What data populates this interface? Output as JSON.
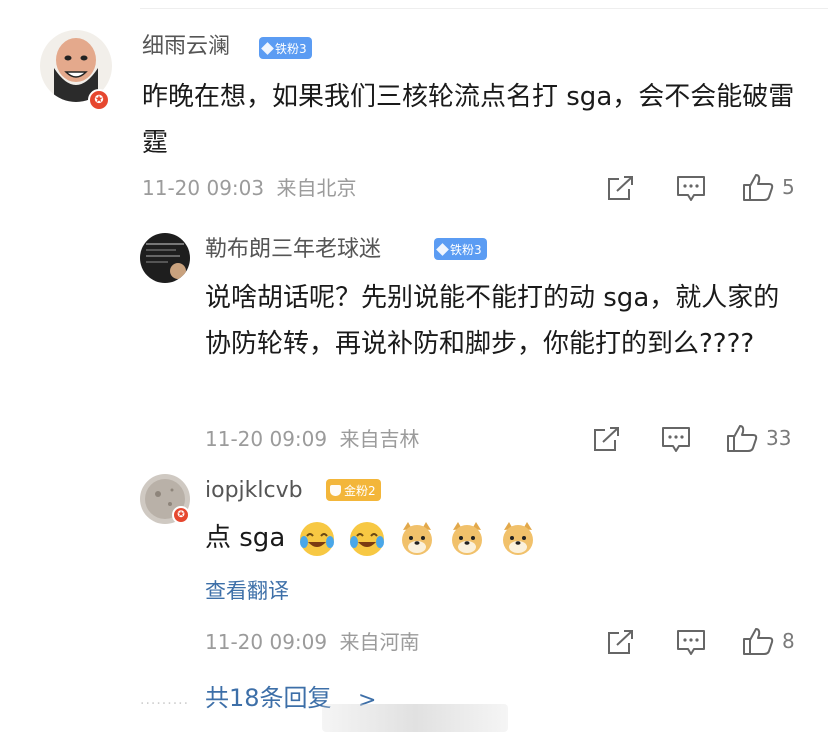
{
  "comments": [
    {
      "username": "细雨云澜",
      "badge": "铁粉3",
      "badge_color": "#5b9cf3",
      "text": "昨晚在想，如果我们三核轮流点名打 sga，会不会能破雷霆",
      "date": "11-20 09:03",
      "location": "来自北京",
      "likes": "5"
    }
  ],
  "replies": [
    {
      "username": "勒布朗三年老球迷",
      "badge": "铁粉3",
      "badge_color": "#5b9cf3",
      "text": "说啥胡话呢？先别说能不能打的动 sga，就人家的协防轮转，再说补防和脚步，你能打的到么????",
      "date": "11-20 09:09",
      "location": "来自吉林",
      "likes": "33"
    },
    {
      "username": "iopjklcvb",
      "badge": "金粉2",
      "badge_color": "#f3b63a",
      "text": "点 sga",
      "emojis": [
        "laugh-cry-emoji",
        "laugh-cry-emoji",
        "doge-emoji",
        "doge-emoji",
        "doge-emoji"
      ],
      "translate": "查看翻译",
      "date": "11-20 09:09",
      "location": "来自河南",
      "likes": "8"
    }
  ],
  "more_replies": "共18条回复",
  "more_arrow": ">",
  "icons": [
    "share-icon",
    "comment-icon",
    "like-icon",
    "verified-icon"
  ],
  "colors": {
    "link": "#3d6fa8",
    "meta": "#9b9b9b",
    "verified": "#e6472f"
  }
}
